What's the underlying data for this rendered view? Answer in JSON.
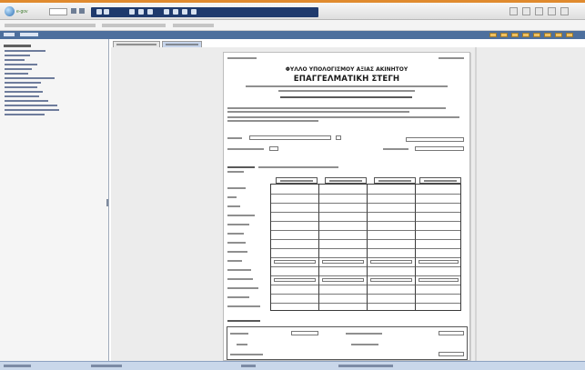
{
  "window": {
    "accent_color": "#e08a2e",
    "toolbar_color": "#1f3a6d",
    "menubar_color": "#4d6f9d",
    "statusbar_color": "#c9d7ea"
  },
  "toolbar": {
    "logo_icon": "globe-icon",
    "logo_text": "e-gov"
  },
  "tabs": [
    {
      "label": ""
    },
    {
      "label": ""
    }
  ],
  "document": {
    "form_title": "ΦΥΛΛΟ ΥΠΟΛΟΓΙΣΜΟΥ ΑΞΙΑΣ ΑΚΙΝΗΤΟΥ",
    "form_subtitle": "ΕΠΑΓΓΕΛΜΑΤΙΚΗ ΣΤΕΓΗ"
  }
}
